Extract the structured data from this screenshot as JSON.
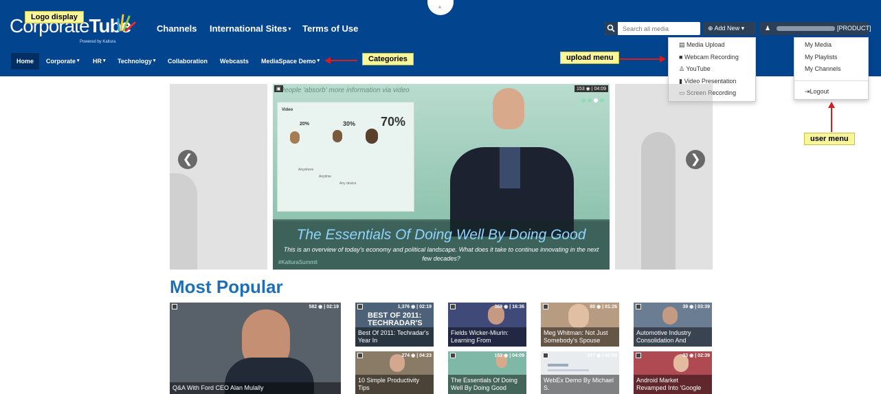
{
  "brand": {
    "logo_light": "Corporate",
    "logo_bold": "Tube",
    "powered": "Powered by Kaltura"
  },
  "colors": {
    "header_bg": "#03448e",
    "annotation_bg": "#f9f69a",
    "arrow": "#d81d1d",
    "heading": "#1f6fb6"
  },
  "topnav": [
    {
      "label": "Channels",
      "has_caret": false
    },
    {
      "label": "International Sites",
      "has_caret": true
    },
    {
      "label": "Terms of Use",
      "has_caret": false
    }
  ],
  "subnav": [
    {
      "label": "Home",
      "active": true
    },
    {
      "label": "Corporate",
      "caret": "▾"
    },
    {
      "label": "HR",
      "caret": "▾"
    },
    {
      "label": "Technology",
      "caret": "▾"
    },
    {
      "label": "Collaboration"
    },
    {
      "label": "Webcasts"
    },
    {
      "label": "MediaSpace Demo",
      "caret": "▾"
    }
  ],
  "search": {
    "placeholder": "Search all media",
    "icon": "search-icon"
  },
  "add_new": {
    "label": "⊕ Add New ▾"
  },
  "user": {
    "product_label": "[PRODUCT] ▾",
    "icon": "user-icon"
  },
  "upload_menu": [
    {
      "icon": "▤",
      "label": "Media Upload"
    },
    {
      "icon": "■",
      "label": "Webcam Recording"
    },
    {
      "icon": "♙",
      "label": "YouTube"
    },
    {
      "icon": "▮",
      "label": "Video Presentation"
    },
    {
      "icon": "▭",
      "label": "Screen Recording"
    }
  ],
  "user_menu": {
    "items": [
      "My Media",
      "My Playlists",
      "My Channels"
    ],
    "logout": "⇥Logout"
  },
  "annotations": {
    "logo": "Logo display",
    "categories": "Categories",
    "upload": "upload menu",
    "user": "user menu"
  },
  "carousel": {
    "title": "The Essentials Of Doing Well By Doing Good",
    "description": "This is an overview of today's economy and political landscape. What does it take to continue innovating in the next few decades?",
    "stats": "153 ◉ | 04:09",
    "slide_text": "e People 'absorb' more information via video",
    "board_video": "Video",
    "percent_1": "20%",
    "percent_2": "30%",
    "percent_3": "70%",
    "anywhere": "Anywhere",
    "anytime": "Anytime",
    "any_device": "Any device",
    "hashtag": "#KalturaSummit",
    "prev": "❮",
    "next": "❯"
  },
  "most_popular": {
    "heading": "Most Popular",
    "featured": {
      "title": "Q&A With Ford CEO Alan Mulally",
      "stats": "582 ◉ | 02:19"
    },
    "items": [
      {
        "title": "Best Of 2011: Techradar's Year In",
        "stats": "1,376 ◉ | 02:19",
        "overlay": "BEST OF 2011: TECHRADAR'S"
      },
      {
        "title": "Fields Wicker-Miurin: Learning From",
        "stats": "369 ◉ | 16:36"
      },
      {
        "title": "Meg Whitman: Not Just Somebody's Spouse",
        "stats": "88 ◉ | 01:26"
      },
      {
        "title": "Automotive Industry Consolidation And",
        "stats": "39 ◉ | 03:39"
      },
      {
        "title": "10 Simple Productivity Tips",
        "stats": "274 ◉ | 04:23"
      },
      {
        "title": "The Essentials Of Doing Well By Doing Good",
        "stats": "153 ◉ | 04:09"
      },
      {
        "title": "WebEx Demo By Michael S.",
        "stats": "367 ◉ | 02:59"
      },
      {
        "title": "Android Market Revamped Into 'Google",
        "stats": "33 ◉ | 02:39"
      }
    ]
  }
}
